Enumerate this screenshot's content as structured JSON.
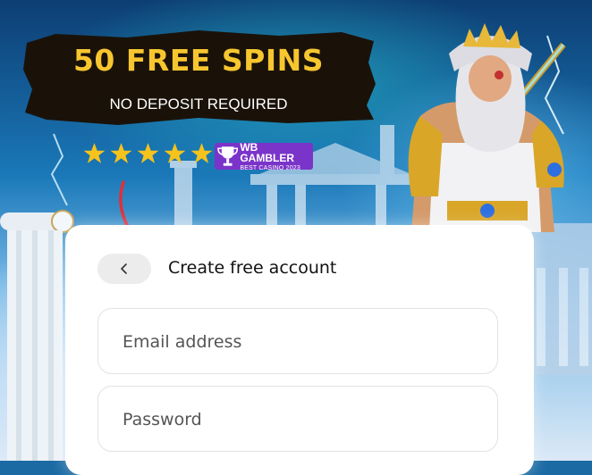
{
  "promo": {
    "title": "50 FREE SPINS",
    "subtitle": "NO DEPOSIT REQUIRED",
    "rating_stars": 5,
    "award": {
      "line1": "WB GAMBLER",
      "line2": "BEST CASINO 2023"
    }
  },
  "form": {
    "title": "Create free account",
    "back_icon": "chevron-left-icon",
    "email_placeholder": "Email address",
    "email_value": "",
    "password_placeholder": "Password",
    "password_value": ""
  },
  "colors": {
    "banner_title": "#f7c62f",
    "banner_bg": "#1a1209",
    "star": "#f6c21c",
    "award_bg": "#7b34c9",
    "arrow": "#e0303a"
  }
}
